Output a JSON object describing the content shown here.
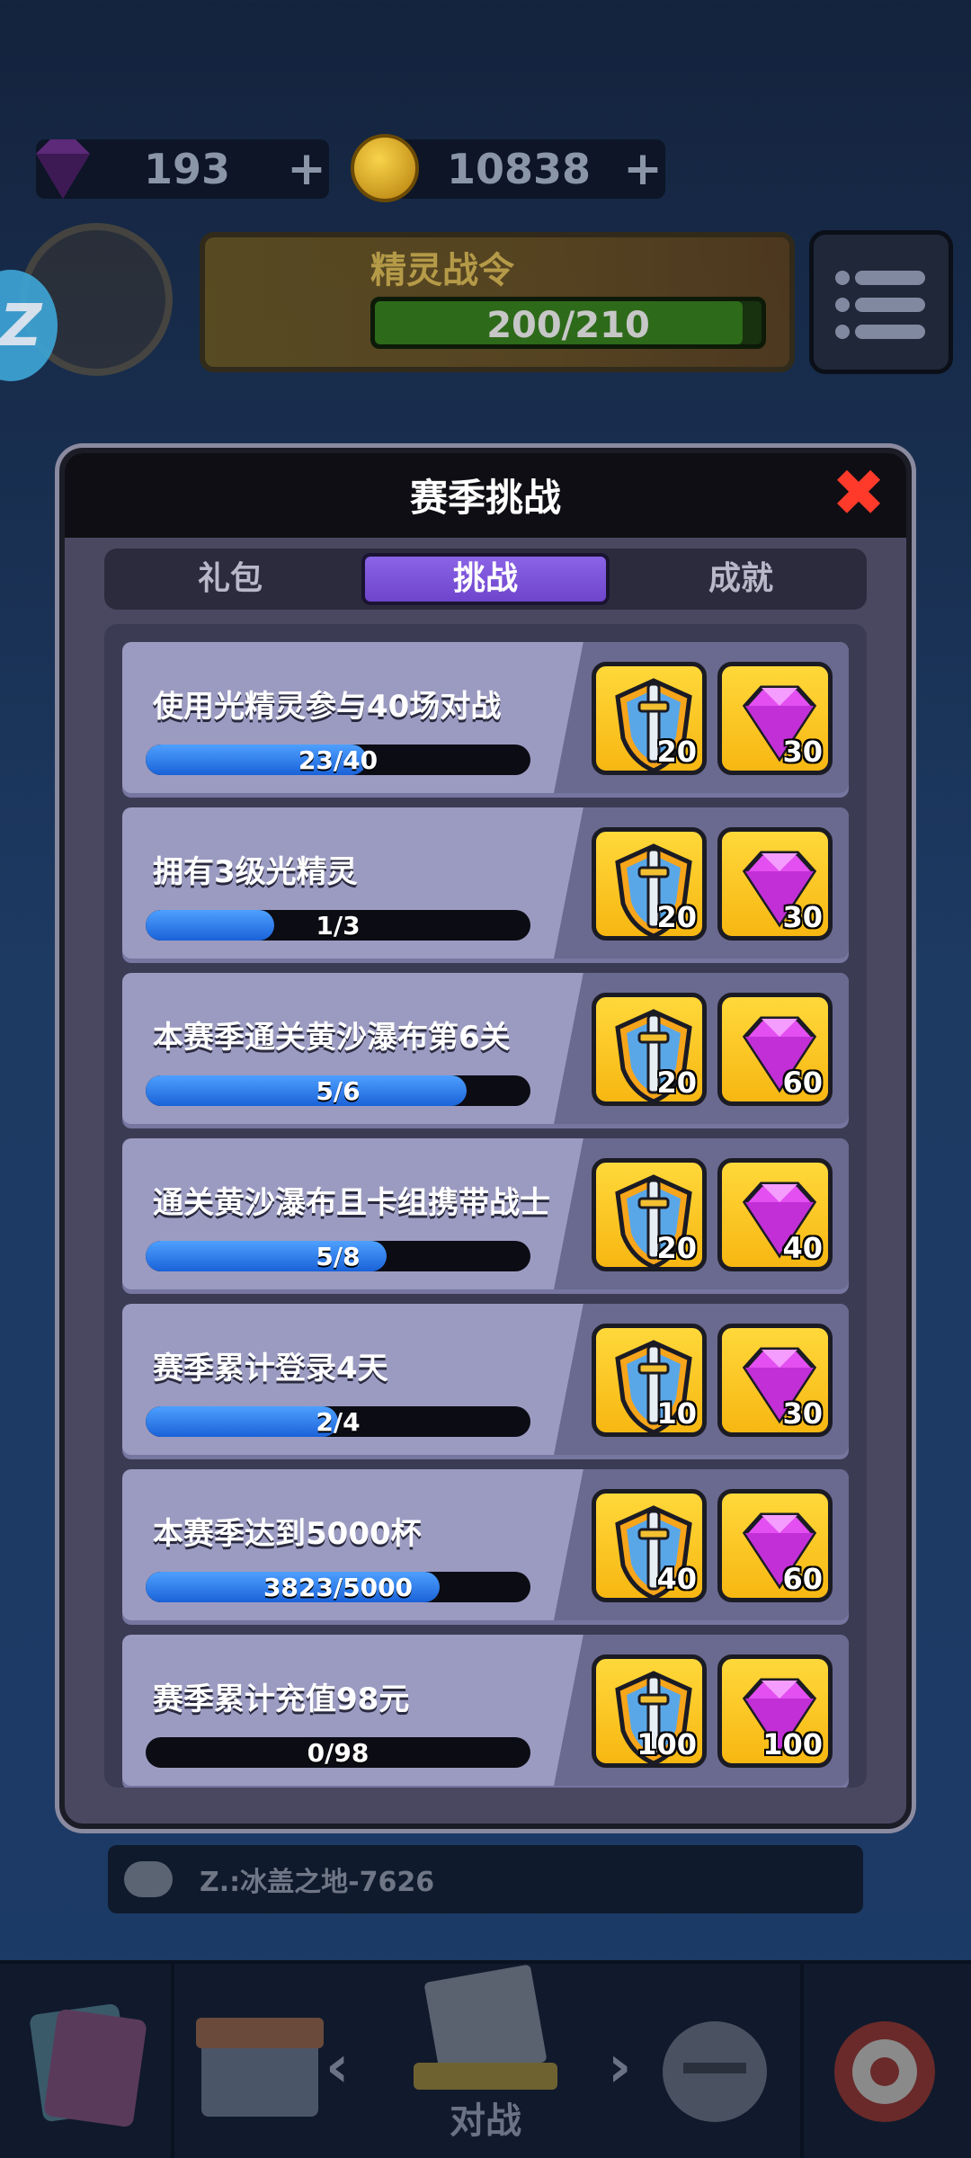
{
  "hud": {
    "gems": "193",
    "coins": "10838",
    "plus": "+",
    "pass_title": "精灵战令",
    "pass_progress": "200/210",
    "side_badge": "Z"
  },
  "modal": {
    "title": "赛季挑战",
    "tabs": [
      "礼包",
      "挑战",
      "成就"
    ],
    "active_tab": 1
  },
  "challenges": [
    {
      "title": "使用光精灵参与40场对战",
      "progress": "23/40",
      "fraction": 0.575,
      "shield": "20",
      "gems": "30"
    },
    {
      "title": "拥有3级光精灵",
      "progress": "1/3",
      "fraction": 0.333,
      "shield": "20",
      "gems": "30"
    },
    {
      "title": "本赛季通关黄沙瀑布第6关",
      "progress": "5/6",
      "fraction": 0.833,
      "shield": "20",
      "gems": "60"
    },
    {
      "title": "通关黄沙瀑布且卡组携带战士",
      "progress": "5/8",
      "fraction": 0.625,
      "shield": "20",
      "gems": "40"
    },
    {
      "title": "赛季累计登录4天",
      "progress": "2/4",
      "fraction": 0.5,
      "shield": "10",
      "gems": "30"
    },
    {
      "title": "本赛季达到5000杯",
      "progress": "3823/5000",
      "fraction": 0.765,
      "shield": "40",
      "gems": "60"
    },
    {
      "title": "赛季累计充值98元",
      "progress": "0/98",
      "fraction": 0.0,
      "shield": "100",
      "gems": "100"
    }
  ],
  "chat": {
    "text": "Z.:冰盖之地-7626"
  },
  "nav": {
    "battle_label": "对战"
  },
  "colors": {
    "accent_tab": "#7a55d8",
    "progress_fill": "#2a78f0",
    "reward_bg": "#ffcc22",
    "close": "#ff3a2a"
  }
}
